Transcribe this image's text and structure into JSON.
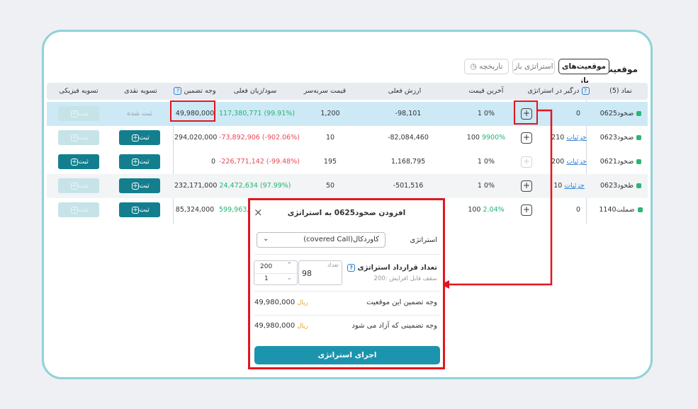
{
  "header": {
    "title": "موقعیت‌ها",
    "tabs": [
      {
        "label": "موقعیت‌های باز",
        "active": true
      },
      {
        "label": "استراتژی باز",
        "active": false
      },
      {
        "label": "تاریخچه",
        "active": false
      }
    ]
  },
  "table": {
    "columns": [
      "نماد (5)",
      "درگیر در استراتژی",
      "آخرین قیمت",
      "ارزش فعلی",
      "قیمت سربه‌سر",
      "سود/زیان فعلی",
      "وجه تضمین",
      "تسویه نقدی",
      "تسویه فیزیکی"
    ],
    "rows": [
      {
        "symbol": "ضخود0625",
        "engaged": "0",
        "link": "",
        "last_price": "1",
        "last_pct": "0%",
        "value": "-98,101",
        "breakeven": "1,200",
        "pnl": "117,380,771 (99.91%)",
        "pnl_color": "green",
        "margin": "49,980,000",
        "cash": "ثبت شده",
        "physical": "ثبت"
      },
      {
        "symbol": "ضخود0623",
        "engaged": "210",
        "link": "جزئیات",
        "last_price": "100",
        "last_pct": "9900%",
        "value": "-82,084,460",
        "breakeven": "10",
        "pnl": "-73,892,906 (-902.06%)",
        "pnl_color": "red",
        "margin": "294,020,000",
        "cash": "ثبت",
        "physical": "ثبت"
      },
      {
        "symbol": "ضخود0621",
        "engaged": "200",
        "link": "جزئیات",
        "last_price": "1",
        "last_pct": "0%",
        "value": "1,168,795",
        "breakeven": "195",
        "pnl": "-226,771,142 (-99.48%)",
        "pnl_color": "red",
        "margin": "0",
        "cash": "ثبت",
        "physical": "ثبت"
      },
      {
        "symbol": "طخود0623",
        "engaged": "10",
        "link": "جزئیات",
        "last_price": "1",
        "last_pct": "0%",
        "value": "-501,516",
        "breakeven": "50",
        "pnl": "24,472,634 (97.99%)",
        "pnl_color": "green",
        "margin": "232,171,000",
        "cash": "ثبت",
        "physical": "ثبت"
      },
      {
        "symbol": "ضملت1140",
        "engaged": "0",
        "link": "",
        "last_price": "100",
        "last_pct": "2.04%",
        "value": "",
        "breakeven": "",
        "pnl": "599,963,",
        "pnl_color": "green",
        "margin": "85,324,000",
        "cash": "ثبت",
        "physical": "ثبت"
      }
    ]
  },
  "modal": {
    "title": "افزودن ضخود0625 به استراتژی",
    "strategy_label": "استراتژی",
    "strategy_value": "(covered Call)کاوردکال",
    "count_label": "تعداد قرارداد استراتژی",
    "count_hint": "سقف قابل افزایش :200",
    "count_field_label": "تعداد",
    "count_value": "98",
    "stepper_max": "200",
    "stepper_min": "1",
    "margin_label": "وجه تضمین این موقعیت",
    "margin_value": "49,980,000",
    "freed_label": "وجه تضمینی که آزاد می شود",
    "freed_value": "49,980,000",
    "currency": "ریال",
    "run_label": "اجرای استراتژی"
  },
  "colors": {
    "accent": "#137f8e",
    "highlight": "#cde9f6",
    "annotation": "#e3151e",
    "positive": "#22b573",
    "negative": "#e84855"
  }
}
